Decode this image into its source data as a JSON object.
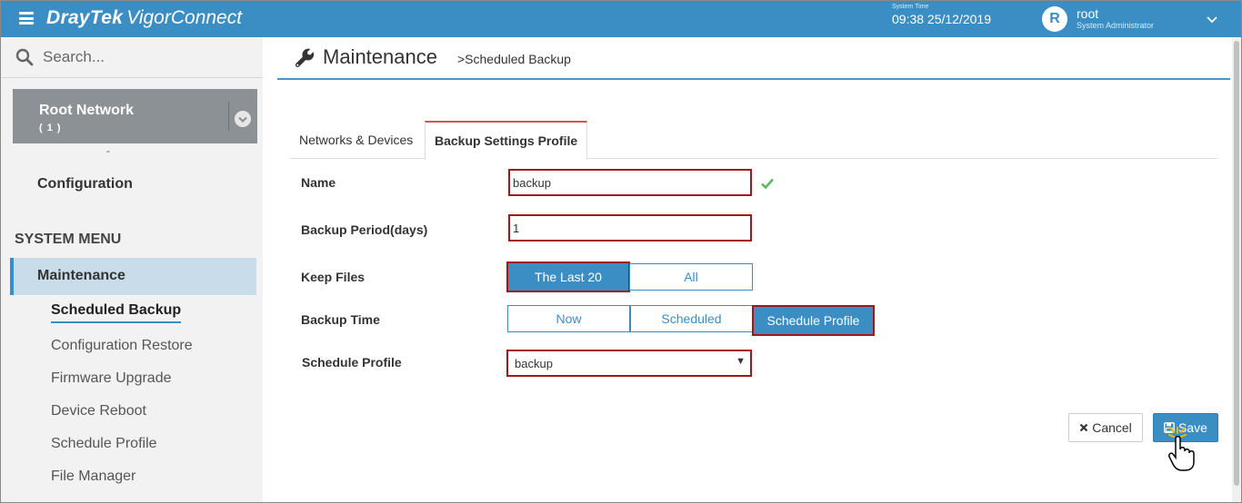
{
  "topbar": {
    "brand": "DrayTek",
    "product": "VigorConnect",
    "system_time_label": "System Time",
    "system_time": "09:38 25/12/2019",
    "avatar_letter": "R",
    "username": "root",
    "role": "System Administrator",
    "accent_color": "#3a8ec4"
  },
  "sidebar": {
    "search_placeholder": "Search...",
    "root_network": {
      "title": "Root Network",
      "count": "( 1 )"
    },
    "dash": "-",
    "configuration": "Configuration",
    "system_menu": "SYSTEM MENU",
    "maintenance": "Maintenance",
    "items": [
      {
        "label": "Scheduled Backup",
        "active": true
      },
      {
        "label": "Configuration Restore"
      },
      {
        "label": "Firmware Upgrade"
      },
      {
        "label": "Device Reboot"
      },
      {
        "label": "Schedule Profile"
      },
      {
        "label": "File Manager"
      }
    ]
  },
  "page": {
    "title": "Maintenance",
    "breadcrumb": ">Scheduled Backup"
  },
  "tabs": [
    {
      "label": "Networks & Devices",
      "active": false
    },
    {
      "label": "Backup Settings Profile",
      "active": true
    }
  ],
  "form": {
    "name_label": "Name",
    "name_value": "backup",
    "period_label": "Backup Period(days)",
    "period_value": "1",
    "keep_label": "Keep Files",
    "keep_options": [
      "The Last 20",
      "All"
    ],
    "keep_selected": "The Last 20",
    "time_label": "Backup Time",
    "time_options": [
      "Now",
      "Scheduled",
      "Schedule Profile"
    ],
    "time_selected": "Schedule Profile",
    "profile_label": "Schedule Profile",
    "profile_value": "backup",
    "highlight_color": "#a4161a"
  },
  "actions": {
    "cancel": "Cancel",
    "save": "Save"
  }
}
